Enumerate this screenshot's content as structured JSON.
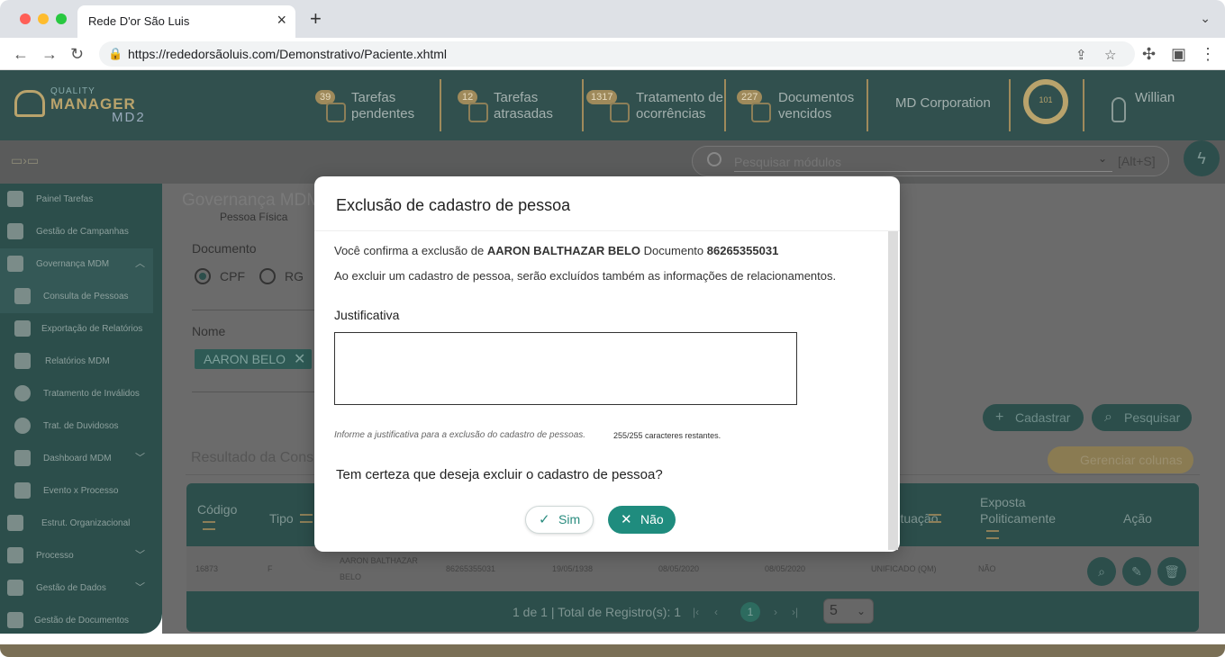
{
  "browser": {
    "tab_title": "Rede D'or São Luis",
    "url": "https://rededorsãoluis.com/Demonstrativo/Paciente.xhtml"
  },
  "header": {
    "logo": {
      "top": "QUALITY",
      "main": "MANAGER",
      "sub": "MD2"
    },
    "items": [
      {
        "badge": "39",
        "line1": "Tarefas",
        "line2": "pendentes"
      },
      {
        "badge": "12",
        "line1": "Tarefas",
        "line2": "atrasadas"
      },
      {
        "badge": "1317",
        "line1": "Tratamento de",
        "line2": "ocorrências"
      },
      {
        "badge": "227",
        "line1": "Documentos",
        "line2": "vencidos"
      }
    ],
    "corporation": "MD Corporation",
    "gauge_value": "101",
    "user": "Willian"
  },
  "toolbar": {
    "search_placeholder": "Pesquisar módulos",
    "shortcut": "[Alt+S]"
  },
  "sidebar": {
    "items": [
      {
        "label": "Painel Tarefas"
      },
      {
        "label": "Gestão de Campanhas"
      },
      {
        "label": "Governança MDM"
      },
      {
        "label": "Consulta de Pessoas"
      },
      {
        "label": "Exportação de Relatórios"
      },
      {
        "label": "Relatórios MDM"
      },
      {
        "label": "Tratamento de Inválidos"
      },
      {
        "label": "Trat. de Duvidosos"
      },
      {
        "label": "Dashboard MDM"
      },
      {
        "label": "Evento x Processo"
      },
      {
        "label": "Estrut. Organizacional"
      },
      {
        "label": "Processo"
      },
      {
        "label": "Gestão de Dados"
      },
      {
        "label": "Gestão de Documentos"
      }
    ]
  },
  "main": {
    "title": "Governança MDM",
    "pessoa_fisica": "Pessoa Física",
    "documento_label": "Documento",
    "doc_options": [
      "CPF",
      "RG"
    ],
    "nome_label": "Nome",
    "nome_chip": "AARON BELO",
    "btn_cadastrar": "Cadastrar",
    "btn_pesquisar": "Pesquisar",
    "result_title": "Resultado da Consulta",
    "btn_gerenciar": "Gerenciar colunas",
    "columns": {
      "codigo": "Código",
      "tipo": "Tipo",
      "situacao": "Situação",
      "exposta1": "Exposta",
      "exposta2": "Politicamente",
      "acao": "Ação"
    },
    "row": {
      "codigo": "16873",
      "tipo": "F",
      "nome1": "AARON BALTHAZAR",
      "nome2": "BELO",
      "documento": "86265355031",
      "nascimento": "19/05/1938",
      "data1": "08/05/2020",
      "data2": "08/05/2020",
      "situacao": "UNIFICADO (QM)",
      "exposta": "NÃO"
    },
    "pagination": "1 de 1 | Total de Registro(s): 1",
    "current_page": "1",
    "page_size": "5"
  },
  "modal": {
    "title": "Exclusão de cadastro de pessoa",
    "confirm_prefix": "Você confirma a exclusão de",
    "person_name": "AARON BALTHAZAR BELO",
    "doc_word": "Documento",
    "doc_number": "86265355031",
    "warning": "Ao excluir um cadastro de pessoa, serão excluídos também as informações de relacionamentos.",
    "justificativa_label": "Justificativa",
    "justificativa_value": "",
    "hint": "Informe a justificativa para a exclusão do cadastro de pessoas.",
    "char_count": "255/255 caracteres restantes.",
    "question": "Tem certeza que deseja excluir o cadastro de pessoa?",
    "btn_yes": "Sim",
    "btn_no": "Não"
  }
}
